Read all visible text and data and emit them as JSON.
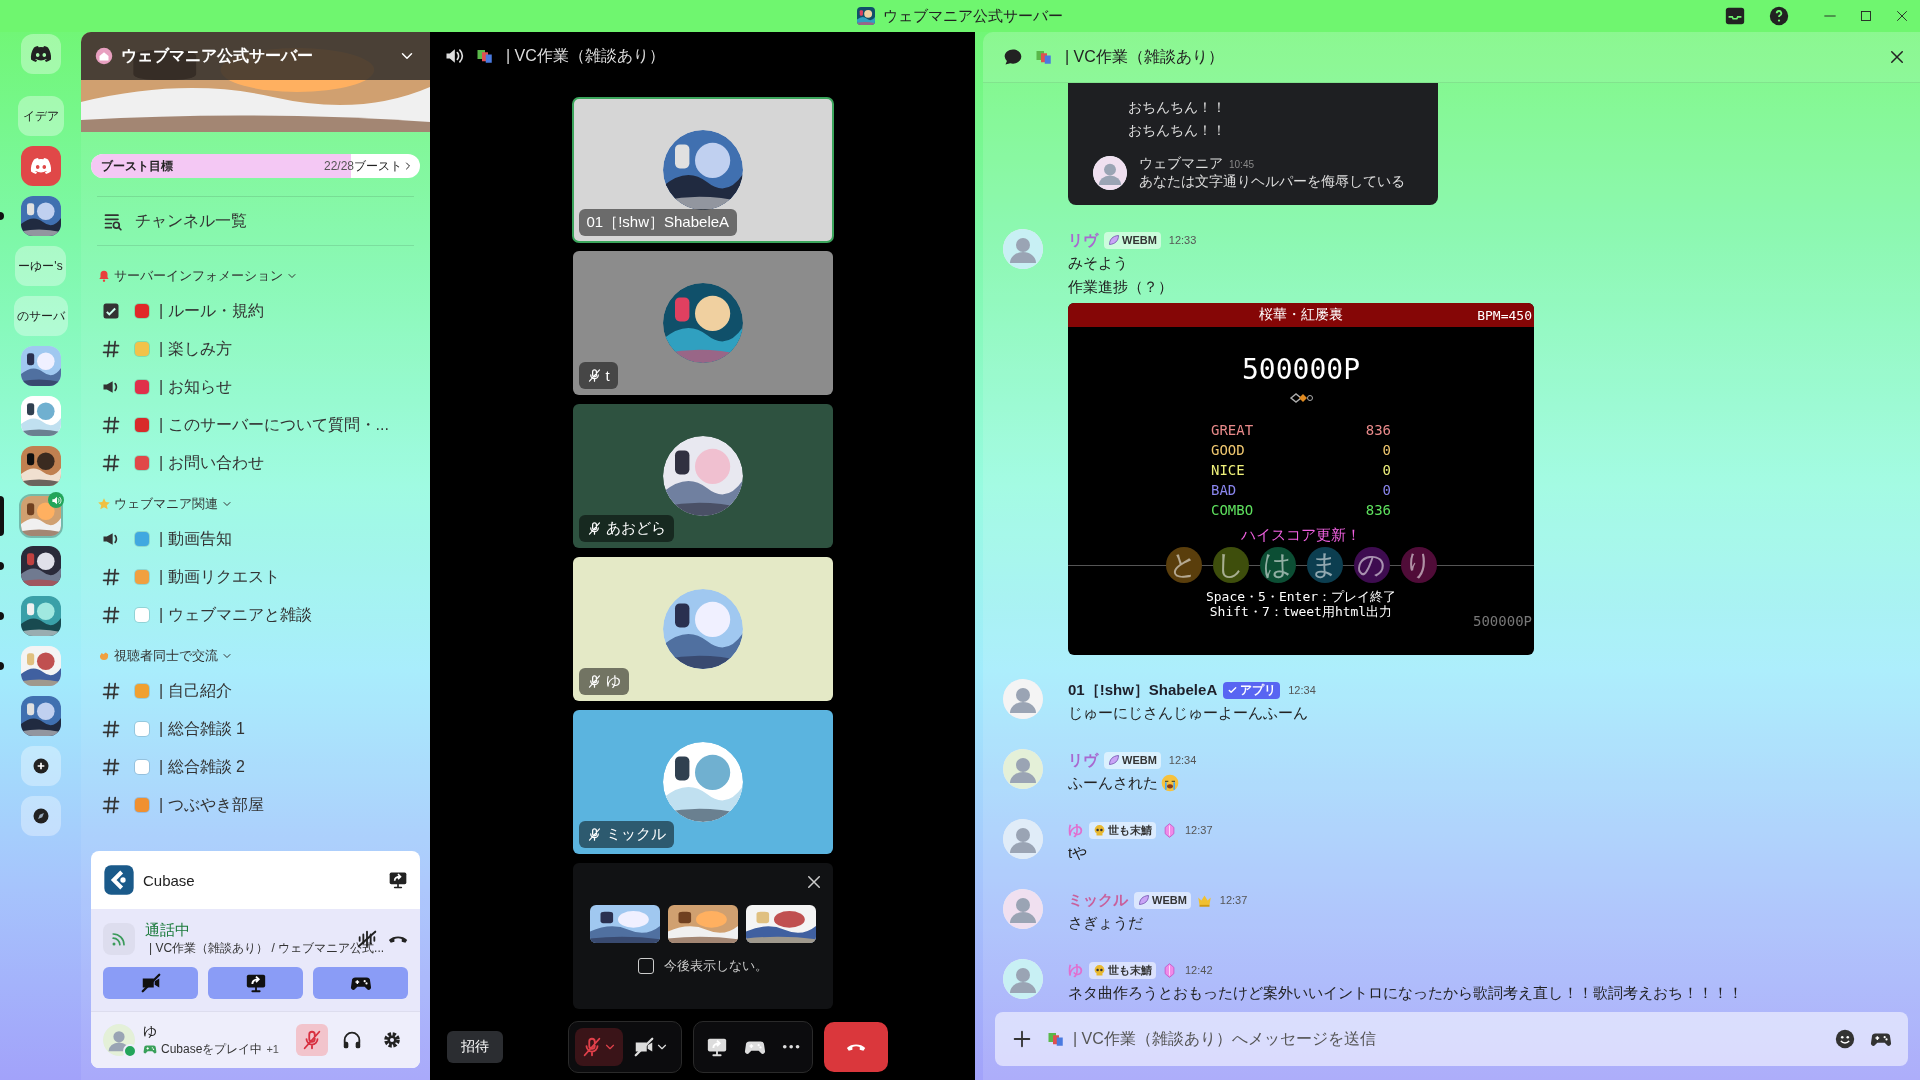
{
  "window": {
    "title": "ウェブマニア公式サーバー"
  },
  "server_rail": [
    {
      "kind": "home",
      "selected": false,
      "unread": false,
      "in_voice": false
    },
    {
      "kind": "text",
      "label": "イデア",
      "selected": false,
      "unread": false,
      "in_voice": false
    },
    {
      "kind": "app",
      "selected": false,
      "unread": false,
      "in_voice": false
    },
    {
      "kind": "picture",
      "selected": false,
      "unread": true,
      "in_voice": false
    },
    {
      "kind": "text",
      "label": "ーゆー's",
      "selected": false,
      "unread": false,
      "in_voice": false
    },
    {
      "kind": "text",
      "label": "のサーバ",
      "selected": false,
      "unread": false,
      "in_voice": false
    },
    {
      "kind": "picture",
      "selected": false,
      "unread": false,
      "in_voice": false
    },
    {
      "kind": "picture",
      "selected": false,
      "unread": false,
      "in_voice": false
    },
    {
      "kind": "picture",
      "selected": false,
      "unread": false,
      "in_voice": false
    },
    {
      "kind": "picture",
      "selected": true,
      "unread": false,
      "in_voice": true
    },
    {
      "kind": "picture",
      "selected": false,
      "unread": true,
      "in_voice": false
    },
    {
      "kind": "picture",
      "selected": false,
      "unread": true,
      "in_voice": false
    },
    {
      "kind": "picture",
      "selected": false,
      "unread": true,
      "in_voice": false
    },
    {
      "kind": "picture",
      "selected": false,
      "unread": false,
      "in_voice": false
    },
    {
      "kind": "add",
      "selected": false,
      "unread": false,
      "in_voice": false
    },
    {
      "kind": "discover",
      "selected": false,
      "unread": false,
      "in_voice": false
    }
  ],
  "sidebar": {
    "server_name": "ウェブマニア公式サーバー",
    "boost": {
      "label": "ブースト目標",
      "progress": "22/28",
      "unit": "ブースト",
      "level": 0.79
    },
    "browse_channels": "チャンネル一覧",
    "categories": [
      {
        "name": "サーバーインフォメーション",
        "color": "#e8403c",
        "expanded": true,
        "channels": [
          {
            "kind": "rules",
            "color": "#e02828",
            "name": "| ルール・規約"
          },
          {
            "kind": "text",
            "color": "#f2c24a",
            "name": "| 楽しみ方"
          },
          {
            "kind": "announce",
            "color": "#e0304a",
            "name": "| お知らせ"
          },
          {
            "kind": "text",
            "color": "#d82a2a",
            "name": "| このサーバーについて質問・..."
          },
          {
            "kind": "text",
            "color": "#e04848",
            "name": "| お問い合わせ"
          }
        ]
      },
      {
        "name": "ウェブマニア関連",
        "color": "#f0c040",
        "expanded": true,
        "channels": [
          {
            "kind": "announce",
            "color": "#40a8e0",
            "name": "| 動画告知"
          },
          {
            "kind": "text",
            "color": "#f0a040",
            "name": "| 動画リクエスト"
          },
          {
            "kind": "text",
            "color": "#ffffff",
            "name": "| ウェブマニアと雑談"
          }
        ]
      },
      {
        "name": "視聴者同士で交流",
        "color": "#f0a040",
        "expanded": true,
        "channels": [
          {
            "kind": "text",
            "color": "#f0a030",
            "name": "| 自己紹介"
          },
          {
            "kind": "text",
            "color": "#ffffff",
            "name": "| 総合雑談 1"
          },
          {
            "kind": "text",
            "color": "#ffffff",
            "name": "| 総合雑談 2"
          },
          {
            "kind": "text",
            "color": "#f09030",
            "name": "| つぶやき部屋"
          }
        ]
      }
    ]
  },
  "activity_panel": {
    "name": "Cubase"
  },
  "voice_panel": {
    "status": "通話中",
    "channel": "| VC作業（雑談あり） / ウェブマニア公式..."
  },
  "user_panel": {
    "name": "ゆ",
    "activity": "Cubaseをプレイ中",
    "extra": "+1",
    "muted": true,
    "online": true
  },
  "voice_view": {
    "title": "| VC作業（雑談あり）",
    "tiles": [
      {
        "name": "01［!shw］ShabeleA",
        "color": "#d6d6d6",
        "speaking": true,
        "muted": false
      },
      {
        "name": "t",
        "color": "#8c8c8c",
        "speaking": false,
        "muted": true
      },
      {
        "name": "あおどら",
        "color": "#2e5240",
        "speaking": false,
        "muted": true
      },
      {
        "name": "ゆ",
        "color": "#e4e9c6",
        "speaking": false,
        "muted": true
      },
      {
        "name": "ミックル",
        "color": "#5bb4df",
        "speaking": false,
        "muted": true
      }
    ],
    "promo": {
      "checkbox": {
        "label": "今後表示しない。",
        "checked": false
      }
    },
    "invite": "招待",
    "mic_muted": true
  },
  "chat": {
    "title": "| VC作業（雑談あり）",
    "quote": {
      "lines": [
        "おちんちん！！",
        "おちんちん！！"
      ],
      "author": "ウェブマニア",
      "time": "10:45",
      "text": "あなたは文字通りヘルパーを侮辱している"
    },
    "messages": [
      {
        "author": "リヴ",
        "color": "#a868d0",
        "tag": {
          "kind": "leaf",
          "label": "WEBM"
        },
        "time": "12:33",
        "lines": [
          "みそよう",
          "作業進捗（？）"
        ],
        "attachment": {
          "title": "桜華・紅屡裏",
          "bpm": "BPM=450",
          "score": "500000P",
          "judgments": [
            {
              "label": "GREAT",
              "value": "836",
              "color": "#e88a8a"
            },
            {
              "label": "GOOD",
              "value": "0",
              "color": "#f0c870"
            },
            {
              "label": "NICE",
              "value": "0",
              "color": "#eef07a"
            },
            {
              "label": "BAD",
              "value": "0",
              "color": "#8a86ee"
            },
            {
              "label": "COMBO",
              "value": "836",
              "color": "#5ee05e"
            }
          ],
          "highscore": "ハイスコア更新！",
          "keys": [
            {
              "label": "と",
              "color": "#5a3e0c"
            },
            {
              "label": "し",
              "color": "#3e4e0c"
            },
            {
              "label": "は",
              "color": "#0c4e34"
            },
            {
              "label": "ま",
              "color": "#0c3e50"
            },
            {
              "label": "の",
              "color": "#3e0c50"
            },
            {
              "label": "り",
              "color": "#500c38"
            }
          ],
          "help": [
            "Space・5・Enter：プレイ終了",
            "Shift・7：tweet用html出力"
          ],
          "footer_score": "500000P"
        }
      },
      {
        "author": "01［!shw］ShabeleA",
        "color": "#1e1f2a",
        "tag": {
          "kind": "app",
          "label": "アプリ"
        },
        "time": "12:34",
        "lines": [
          "じゅーにじさんじゅーよーんふーん"
        ]
      },
      {
        "author": "リヴ",
        "color": "#a868d0",
        "tag": {
          "kind": "leaf",
          "label": "WEBM"
        },
        "time": "12:34",
        "lines": [
          "ふーんされた"
        ],
        "emoji": {
          "kind": "crying"
        }
      },
      {
        "author": "ゆ",
        "color": "#e070d0",
        "tag": {
          "kind": "skull",
          "label": "世も末鯖"
        },
        "role": {
          "kind": "gem"
        },
        "time": "12:37",
        "lines": [
          "tや"
        ]
      },
      {
        "author": "ミックル",
        "color": "#c8609c",
        "tag": {
          "kind": "leaf",
          "label": "WEBM"
        },
        "role": {
          "kind": "crown"
        },
        "time": "12:37",
        "lines": [
          "さぎょうだ"
        ]
      },
      {
        "author": "ゆ",
        "color": "#e070d0",
        "tag": {
          "kind": "skull",
          "label": "世も末鯖"
        },
        "role": {
          "kind": "gem"
        },
        "time": "12:42",
        "lines": [
          "ネタ曲作ろうとおもったけど案外いいイントロになったから歌詞考え直し！！歌詞考えおち！！！！"
        ]
      }
    ],
    "placeholder": "| VC作業（雑談あり）へメッセージを送信"
  }
}
